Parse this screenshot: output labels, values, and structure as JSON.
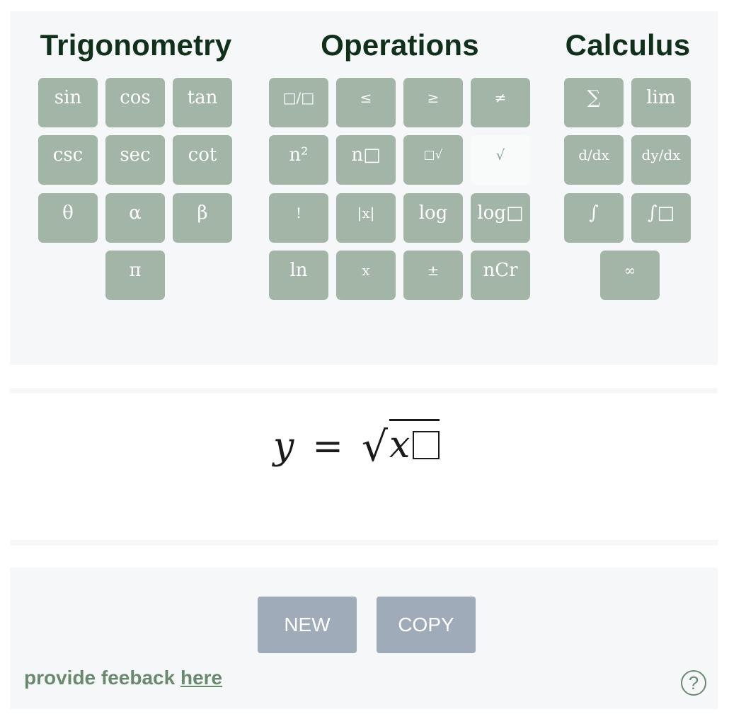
{
  "palette": {
    "trigonometry": {
      "title": "Trigonometry",
      "keys": [
        "sin",
        "cos",
        "tan",
        "csc",
        "sec",
        "cot",
        "θ",
        "α",
        "β",
        "π"
      ]
    },
    "operations": {
      "title": "Operations",
      "keys": [
        "□/□",
        "≤",
        "≥",
        "≠",
        "n²",
        "n□",
        "□√",
        "√",
        "!",
        "|x|",
        "log",
        "log□",
        "ln",
        "x",
        "±",
        "nCr"
      ],
      "active_key": "√"
    },
    "calculus": {
      "title": "Calculus",
      "keys": [
        "∑",
        "lim",
        "d/dx",
        "dy/dx",
        "∫",
        "∫□",
        "∞"
      ]
    }
  },
  "formula": {
    "lhs": "y",
    "equals": "=",
    "radical": "√",
    "radicand": "x"
  },
  "actions": {
    "new_label": "NEW",
    "copy_label": "COPY"
  },
  "feedback": {
    "text": "provide feeback ",
    "link": "here"
  },
  "help": {
    "label": "?"
  },
  "colors": {
    "key_bg": "#a3b5a6",
    "title": "#10301b",
    "button_bg": "#a0abba",
    "link": "#6a8a70"
  }
}
